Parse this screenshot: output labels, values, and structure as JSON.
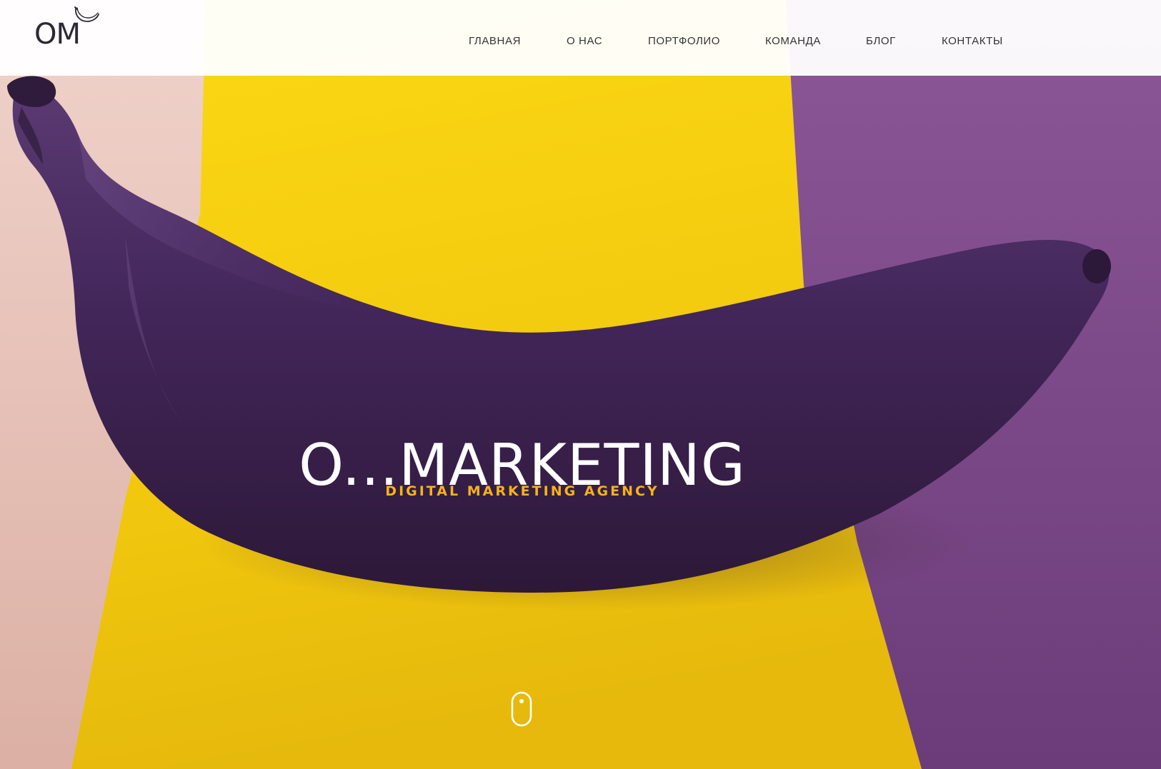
{
  "header": {
    "logo_text": "OM",
    "nav": [
      {
        "label": "ГЛАВНАЯ"
      },
      {
        "label": "О НАС"
      },
      {
        "label": "ПОРТФОЛИО"
      },
      {
        "label": "КОМАНДА"
      },
      {
        "label": "БЛОГ"
      },
      {
        "label": "КОНТАКТЫ"
      }
    ]
  },
  "hero": {
    "title": "O...MARKETING",
    "subtitle": "DIGITAL MARKETING AGENCY",
    "scroll_icon": "mouse-scroll-icon"
  },
  "colors": {
    "pink": "#e9c3b9",
    "yellow": "#f1c812",
    "purple": "#7c4a8b",
    "banana": "#4a2b5c",
    "accent": "#f5b21c"
  }
}
